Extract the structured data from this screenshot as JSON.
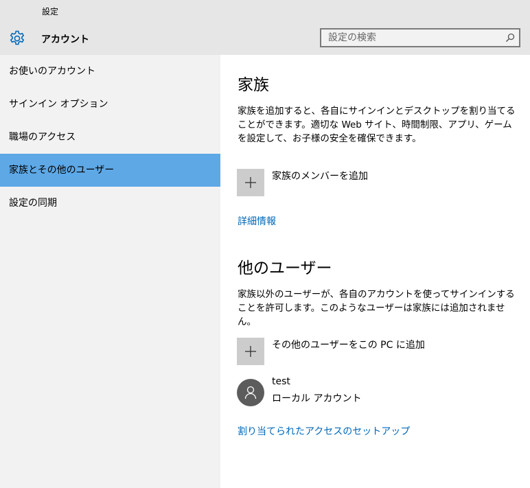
{
  "window": {
    "title": "設定"
  },
  "header": {
    "icon": "gear-icon",
    "page_title": "アカウント",
    "search": {
      "placeholder": "設定の検索",
      "value": "",
      "icon": "search-icon"
    }
  },
  "sidebar": {
    "items": [
      {
        "label": "お使いのアカウント",
        "selected": false
      },
      {
        "label": "サインイン オプション",
        "selected": false
      },
      {
        "label": "職場のアクセス",
        "selected": false
      },
      {
        "label": "家族とその他のユーザー",
        "selected": true
      },
      {
        "label": "設定の同期",
        "selected": false
      }
    ],
    "selected_color": "#5ea8e6"
  },
  "family": {
    "title": "家族",
    "description": "家族を追加すると、各自にサインインとデスクトップを割り当てることができます。適切な Web サイト、時間制限、アプリ、ゲームを設定して、お子様の安全を確保できます。",
    "add_label": "家族のメンバーを追加",
    "more_info_link": "詳細情報"
  },
  "other_users": {
    "title": "他のユーザー",
    "description": "家族以外のユーザーが、各自のアカウントを使ってサインインすることを許可します。このようなユーザーは家族には追加されません。",
    "add_label": "その他のユーザーをこの PC に追加",
    "users": [
      {
        "name": "test",
        "type": "ローカル アカウント",
        "icon": "user-icon"
      }
    ],
    "assigned_access_link": "割り当てられたアクセスのセットアップ"
  },
  "colors": {
    "link": "#0067b8",
    "header_bg": "#e6e6e6",
    "sidebar_bg": "#f2f2f2"
  }
}
